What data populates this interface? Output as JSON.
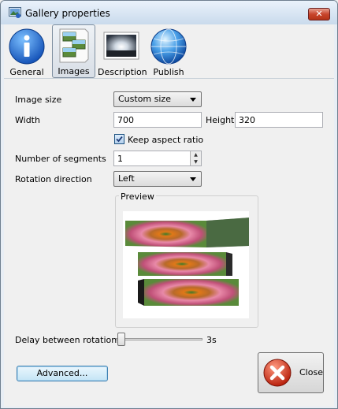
{
  "window": {
    "title": "Gallery properties",
    "close_glyph": "✕"
  },
  "toolbar": {
    "tabs": [
      {
        "label": "General",
        "icon": "info-icon"
      },
      {
        "label": "Images",
        "icon": "images-icon"
      },
      {
        "label": "Description",
        "icon": "description-icon"
      },
      {
        "label": "Publish",
        "icon": "globe-icon"
      }
    ],
    "active_tab": "Images"
  },
  "form": {
    "image_size_label": "Image size",
    "image_size_value": "Custom size",
    "width_label": "Width",
    "width_value": "700",
    "height_label": "Height",
    "height_value": "320",
    "keep_aspect_label": "Keep aspect ratio",
    "keep_aspect_checked": true,
    "segments_label": "Number of segments",
    "segments_value": "1",
    "rotation_label": "Rotation direction",
    "rotation_value": "Left",
    "preview_label": "Preview",
    "delay_label": "Delay between rotations",
    "delay_value": "3s",
    "delay_slider_level": 0
  },
  "buttons": {
    "advanced": "Advanced...",
    "close": "Close"
  },
  "colors": {
    "accent": "#3c7fb1",
    "close_red": "#d0321c",
    "info_blue": "#1f6fd0"
  }
}
